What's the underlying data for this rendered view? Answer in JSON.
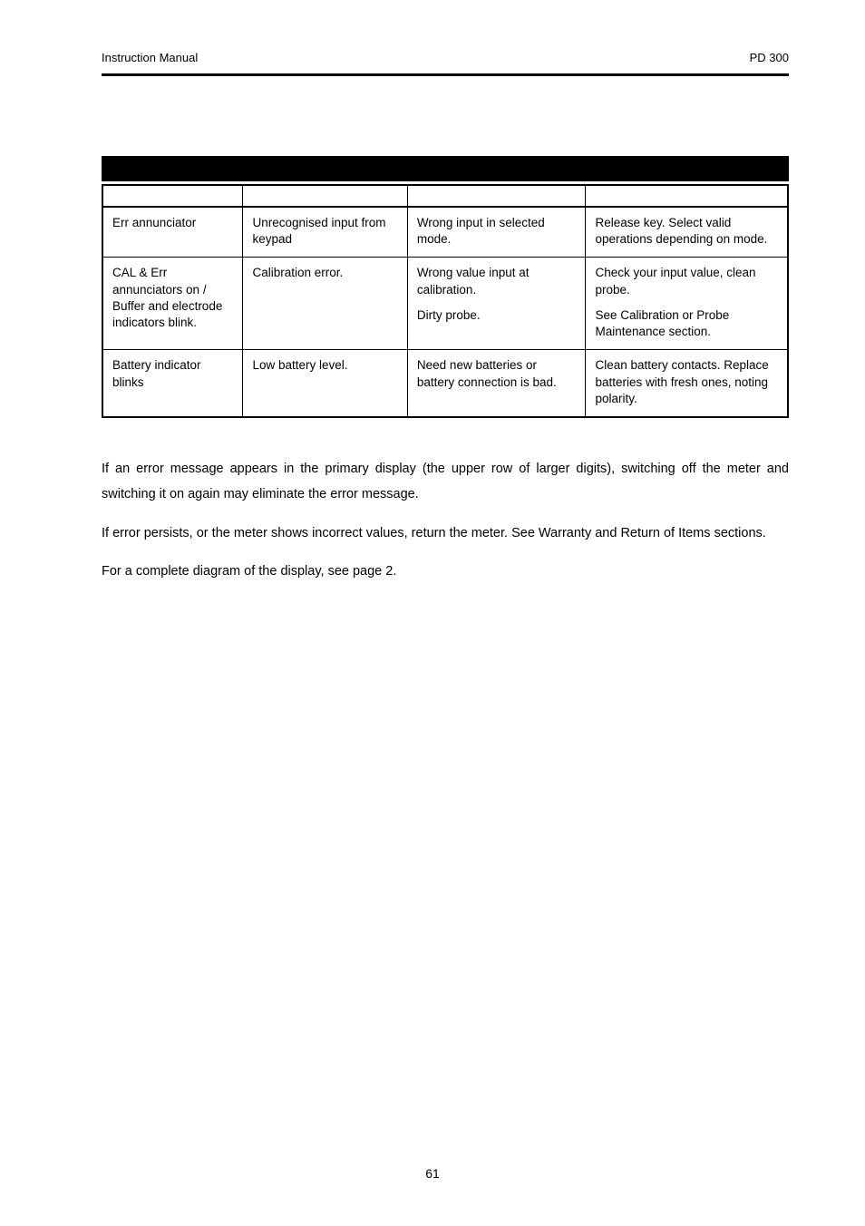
{
  "header": {
    "left": "Instruction Manual",
    "right": "PD 300"
  },
  "table": {
    "rows": [
      {
        "c1": "Err annunciator",
        "c2": "Unrecognised input from keypad",
        "c3": "Wrong input in selected mode.",
        "c4": "Release key. Select valid operations depending on mode."
      },
      {
        "c1": "CAL & Err annunciators on / Buffer and electrode indicators blink.",
        "c2": "Calibration error.",
        "c3": "Wrong value input at calibration.\n\nDirty probe.",
        "c4": "Check your input value, clean probe.\n\nSee Calibration or Probe Maintenance section."
      },
      {
        "c1": "Battery indicator blinks",
        "c2": "Low battery level.",
        "c3": "Need new batteries or battery connection is bad.",
        "c4": "Clean battery contacts. Replace batteries with fresh ones, noting polarity."
      }
    ]
  },
  "paragraphs": {
    "p1": "If an error message appears in the primary display (the upper row of larger digits), switching off the meter and switching it on again may eliminate the error message.",
    "p2": "If error persists, or the meter shows incorrect values, return the meter. See Warranty and Return of Items sections.",
    "p3": "For a complete diagram of the display, see page 2."
  },
  "footer": {
    "page": "61"
  }
}
